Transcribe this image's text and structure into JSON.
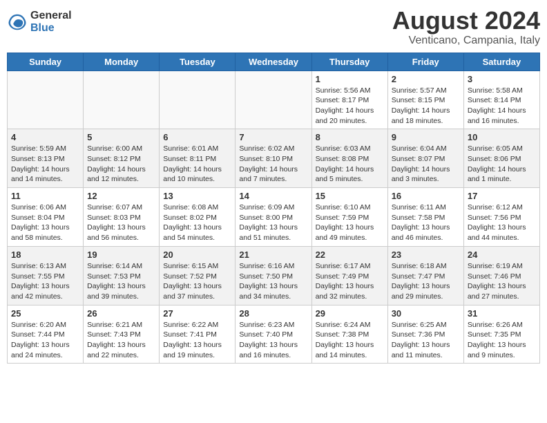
{
  "logo": {
    "general": "General",
    "blue": "Blue"
  },
  "header": {
    "title": "August 2024",
    "subtitle": "Venticano, Campania, Italy"
  },
  "weekdays": [
    "Sunday",
    "Monday",
    "Tuesday",
    "Wednesday",
    "Thursday",
    "Friday",
    "Saturday"
  ],
  "weeks": [
    [
      {
        "day": "",
        "info": ""
      },
      {
        "day": "",
        "info": ""
      },
      {
        "day": "",
        "info": ""
      },
      {
        "day": "",
        "info": ""
      },
      {
        "day": "1",
        "info": "Sunrise: 5:56 AM\nSunset: 8:17 PM\nDaylight: 14 hours\nand 20 minutes."
      },
      {
        "day": "2",
        "info": "Sunrise: 5:57 AM\nSunset: 8:15 PM\nDaylight: 14 hours\nand 18 minutes."
      },
      {
        "day": "3",
        "info": "Sunrise: 5:58 AM\nSunset: 8:14 PM\nDaylight: 14 hours\nand 16 minutes."
      }
    ],
    [
      {
        "day": "4",
        "info": "Sunrise: 5:59 AM\nSunset: 8:13 PM\nDaylight: 14 hours\nand 14 minutes."
      },
      {
        "day": "5",
        "info": "Sunrise: 6:00 AM\nSunset: 8:12 PM\nDaylight: 14 hours\nand 12 minutes."
      },
      {
        "day": "6",
        "info": "Sunrise: 6:01 AM\nSunset: 8:11 PM\nDaylight: 14 hours\nand 10 minutes."
      },
      {
        "day": "7",
        "info": "Sunrise: 6:02 AM\nSunset: 8:10 PM\nDaylight: 14 hours\nand 7 minutes."
      },
      {
        "day": "8",
        "info": "Sunrise: 6:03 AM\nSunset: 8:08 PM\nDaylight: 14 hours\nand 5 minutes."
      },
      {
        "day": "9",
        "info": "Sunrise: 6:04 AM\nSunset: 8:07 PM\nDaylight: 14 hours\nand 3 minutes."
      },
      {
        "day": "10",
        "info": "Sunrise: 6:05 AM\nSunset: 8:06 PM\nDaylight: 14 hours\nand 1 minute."
      }
    ],
    [
      {
        "day": "11",
        "info": "Sunrise: 6:06 AM\nSunset: 8:04 PM\nDaylight: 13 hours\nand 58 minutes."
      },
      {
        "day": "12",
        "info": "Sunrise: 6:07 AM\nSunset: 8:03 PM\nDaylight: 13 hours\nand 56 minutes."
      },
      {
        "day": "13",
        "info": "Sunrise: 6:08 AM\nSunset: 8:02 PM\nDaylight: 13 hours\nand 54 minutes."
      },
      {
        "day": "14",
        "info": "Sunrise: 6:09 AM\nSunset: 8:00 PM\nDaylight: 13 hours\nand 51 minutes."
      },
      {
        "day": "15",
        "info": "Sunrise: 6:10 AM\nSunset: 7:59 PM\nDaylight: 13 hours\nand 49 minutes."
      },
      {
        "day": "16",
        "info": "Sunrise: 6:11 AM\nSunset: 7:58 PM\nDaylight: 13 hours\nand 46 minutes."
      },
      {
        "day": "17",
        "info": "Sunrise: 6:12 AM\nSunset: 7:56 PM\nDaylight: 13 hours\nand 44 minutes."
      }
    ],
    [
      {
        "day": "18",
        "info": "Sunrise: 6:13 AM\nSunset: 7:55 PM\nDaylight: 13 hours\nand 42 minutes."
      },
      {
        "day": "19",
        "info": "Sunrise: 6:14 AM\nSunset: 7:53 PM\nDaylight: 13 hours\nand 39 minutes."
      },
      {
        "day": "20",
        "info": "Sunrise: 6:15 AM\nSunset: 7:52 PM\nDaylight: 13 hours\nand 37 minutes."
      },
      {
        "day": "21",
        "info": "Sunrise: 6:16 AM\nSunset: 7:50 PM\nDaylight: 13 hours\nand 34 minutes."
      },
      {
        "day": "22",
        "info": "Sunrise: 6:17 AM\nSunset: 7:49 PM\nDaylight: 13 hours\nand 32 minutes."
      },
      {
        "day": "23",
        "info": "Sunrise: 6:18 AM\nSunset: 7:47 PM\nDaylight: 13 hours\nand 29 minutes."
      },
      {
        "day": "24",
        "info": "Sunrise: 6:19 AM\nSunset: 7:46 PM\nDaylight: 13 hours\nand 27 minutes."
      }
    ],
    [
      {
        "day": "25",
        "info": "Sunrise: 6:20 AM\nSunset: 7:44 PM\nDaylight: 13 hours\nand 24 minutes."
      },
      {
        "day": "26",
        "info": "Sunrise: 6:21 AM\nSunset: 7:43 PM\nDaylight: 13 hours\nand 22 minutes."
      },
      {
        "day": "27",
        "info": "Sunrise: 6:22 AM\nSunset: 7:41 PM\nDaylight: 13 hours\nand 19 minutes."
      },
      {
        "day": "28",
        "info": "Sunrise: 6:23 AM\nSunset: 7:40 PM\nDaylight: 13 hours\nand 16 minutes."
      },
      {
        "day": "29",
        "info": "Sunrise: 6:24 AM\nSunset: 7:38 PM\nDaylight: 13 hours\nand 14 minutes."
      },
      {
        "day": "30",
        "info": "Sunrise: 6:25 AM\nSunset: 7:36 PM\nDaylight: 13 hours\nand 11 minutes."
      },
      {
        "day": "31",
        "info": "Sunrise: 6:26 AM\nSunset: 7:35 PM\nDaylight: 13 hours\nand 9 minutes."
      }
    ]
  ]
}
